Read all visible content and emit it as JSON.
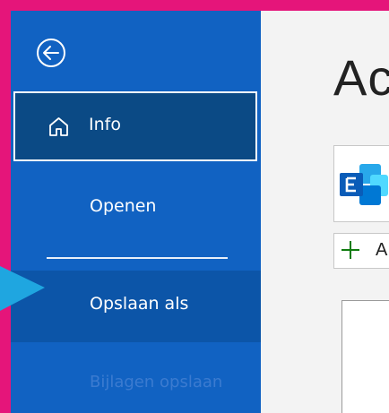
{
  "sidebar": {
    "back_icon": "back-arrow-icon",
    "items": [
      {
        "label": "Info",
        "icon": "home-icon",
        "state": "selected"
      },
      {
        "label": "Openen"
      },
      {
        "label": "Opslaan als",
        "state": "hover"
      },
      {
        "label": "Bijlagen opslaan",
        "state": "disabled"
      }
    ]
  },
  "content": {
    "title": "Ac",
    "account_icon": "exchange-icon",
    "add_account": {
      "icon": "plus-icon",
      "label": "A"
    }
  },
  "annotation": {
    "icon": "pointer-arrow-icon",
    "color": "#1fa6e0"
  },
  "colors": {
    "border_accent": "#e5157a",
    "sidebar_bg": "#1162c2",
    "selected_bg": "#0b4a85",
    "hover_bg": "#0c55a8"
  }
}
